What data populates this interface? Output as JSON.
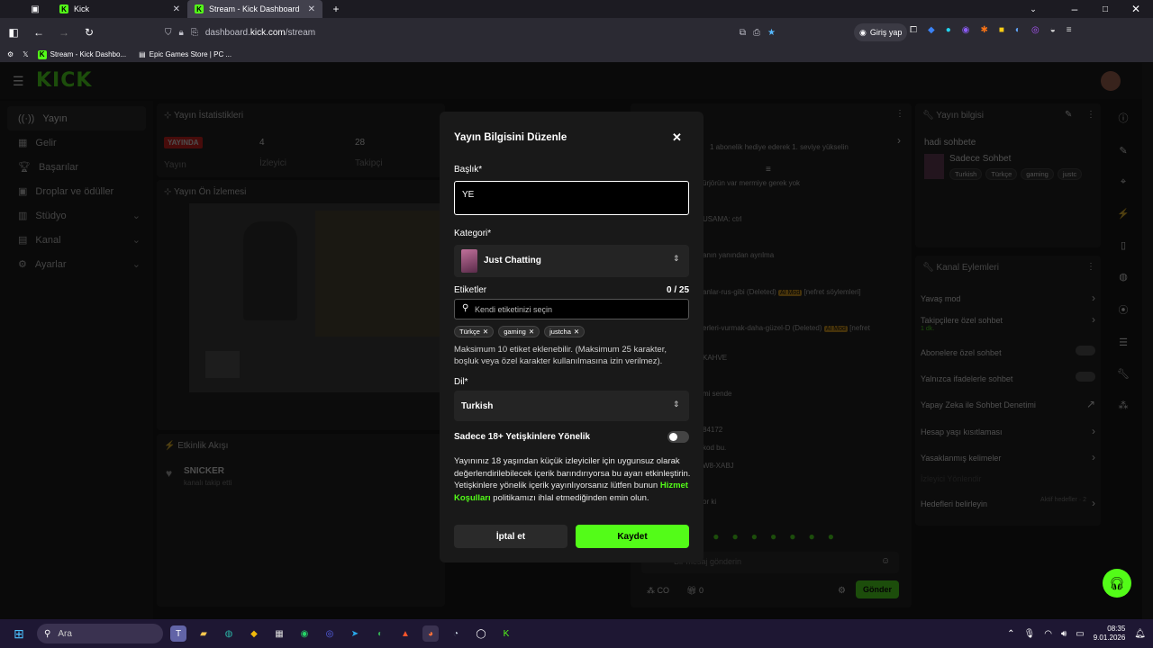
{
  "browser": {
    "tabs": [
      {
        "label": "Kick"
      },
      {
        "label": "Stream - Kick Dashboard"
      }
    ],
    "url_prefix": "dashboard.",
    "url_domain": "kick.com",
    "url_path": "/stream",
    "login_label": "Giriş yap",
    "bookmarks": [
      "Stream - Kick Dashbo...",
      "Epic Games Store | PC ..."
    ]
  },
  "sidebar": {
    "items": [
      {
        "label": "Yayın"
      },
      {
        "label": "Gelir"
      },
      {
        "label": "Başarılar"
      },
      {
        "label": "Droplar ve ödüller"
      },
      {
        "label": "Stüdyo"
      },
      {
        "label": "Kanal"
      },
      {
        "label": "Ayarlar"
      }
    ]
  },
  "stats": {
    "title": "Yayın İstatistikleri",
    "live_badge": "YAYINDA",
    "live_label": "Yayın",
    "viewers_value": "4",
    "viewers_label": "İzleyici",
    "followers_value": "28",
    "followers_label": "Takipçi"
  },
  "preview": {
    "title": "Yayın Ön İzlemesi"
  },
  "activity": {
    "title": "Etkinlik Akışı",
    "user": "SNICKER",
    "event": "kanalı takip etti"
  },
  "chat": {
    "lines": [
      "1 abonelik hediye ederek 1. seviye yükselin",
      "ürjörün var mermiye gerek yok",
      "USAMA: ctrl",
      "anın yanından ayrılma",
      "anlar-rus-gibi (Deleted)",
      "erleri-vurmak-daha-güzel-D (Deleted)",
      "KAHVE",
      "mi sende",
      "84172",
      "kod bu.",
      "W8-XABJ",
      "or ki"
    ],
    "badge": "AI Mod",
    "deleted_note": "[nefret söylemleri]",
    "deleted_note2": "[nefret",
    "input_placeholder": "Bir mesaj gönderin",
    "points": "CO",
    "count": "0",
    "send_label": "Gönder"
  },
  "stream_info": {
    "title": "Yayın bilgisi",
    "stream_title": "hadi sohbete",
    "category": "Sadece Sohbet",
    "tags": [
      "Turkish",
      "Türkçe",
      "gaming",
      "justc"
    ]
  },
  "channel_actions": {
    "title": "Kanal Eylemleri",
    "items": [
      {
        "label": "Yavaş mod"
      },
      {
        "label": "Takipçilere özel sohbet",
        "sub": "1 dk."
      },
      {
        "label": "Abonelere özel sohbet"
      },
      {
        "label": "Yalnızca ifadelerle sohbet"
      },
      {
        "label": "Yapay Zeka ile Sohbet Denetimi"
      },
      {
        "label": "Hesap yaşı kısıtlaması"
      },
      {
        "label": "Yasaklanmış kelimeler"
      },
      {
        "label": "İzleyici Yönlendir"
      },
      {
        "label": "Hedefleri belirleyin",
        "sub": "Aktif hedefler · 2"
      }
    ]
  },
  "modal": {
    "title": "Yayın Bilgisini Düzenle",
    "title_label": "Başlık*",
    "title_value": "YE",
    "category_label": "Kategori*",
    "category_value": "Just Chatting",
    "tags_label": "Etiketler",
    "tags_count": "0 / 25",
    "tags_placeholder": "Kendi etiketinizi seçin",
    "tags": [
      "Türkçe",
      "gaming",
      "justcha"
    ],
    "tags_hint": "Maksimum 10 etiket eklenebilir. (Maksimum 25 karakter, boşluk veya özel karakter kullanılmasına izin verilmez).",
    "language_label": "Dil*",
    "language_value": "Turkish",
    "mature_label": "Sadece 18+ Yetişkinlere Yönelik",
    "mature_on": false,
    "mature_text_1": "Yayınınız 18 yaşından küçük izleyiciler için uygunsuz olarak değerlendirilebilecek içerik barındırıyorsa bu ayarı etkinleştirin. Yetişkinlere yönelik içerik yayınlıyorsanız lütfen bunun ",
    "mature_link": "Hizmet Koşulları",
    "mature_text_2": " politikamızı ihlal etmediğinden emin olun.",
    "cancel_label": "İptal et",
    "save_label": "Kaydet"
  },
  "taskbar": {
    "search_placeholder": "Ara",
    "time": "08:35",
    "date": "9.01.2026"
  },
  "colors": {
    "brand": "#53fc18",
    "modal_bg": "#191919"
  }
}
